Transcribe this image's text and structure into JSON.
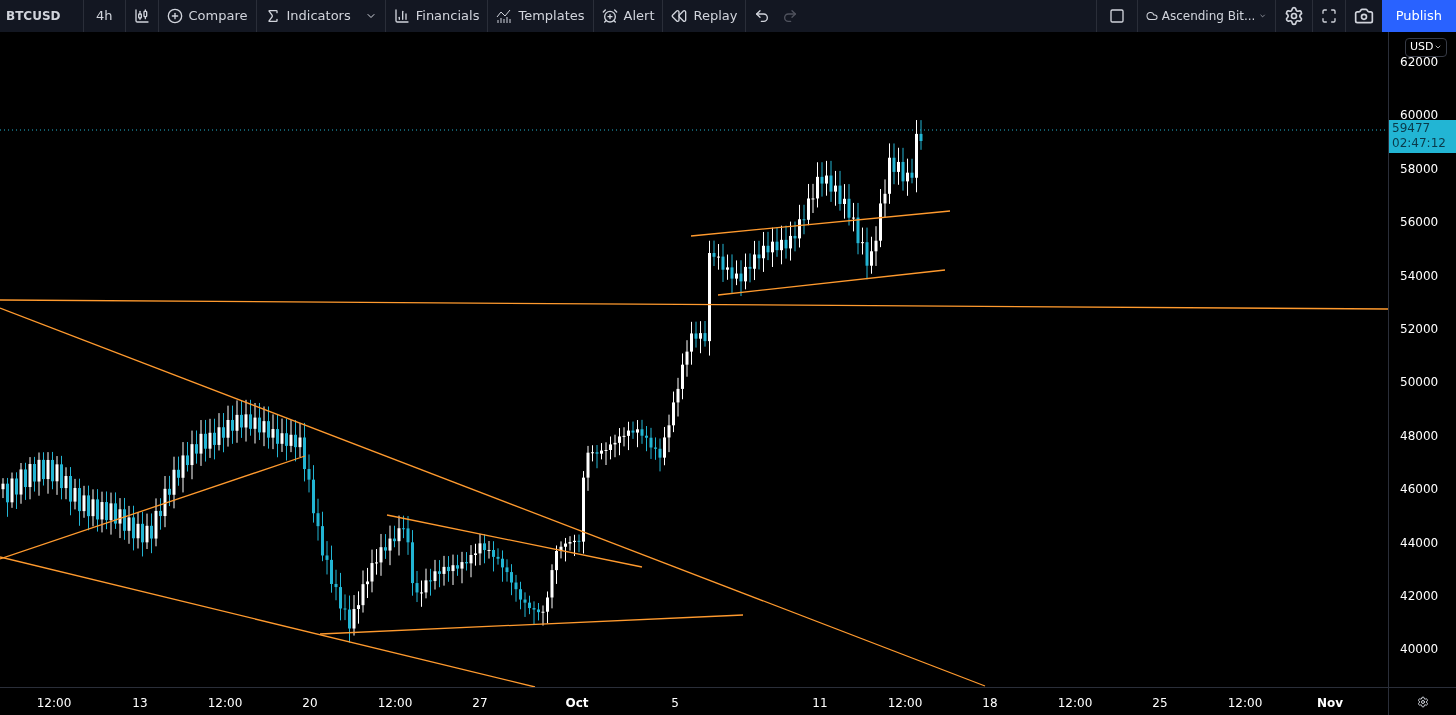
{
  "toolbar": {
    "symbol": "BTCUSD",
    "interval": "4h",
    "items": [
      {
        "kind": "compare",
        "label": "Compare"
      },
      {
        "kind": "indicators",
        "label": "Indicators"
      },
      {
        "kind": "financials",
        "label": "Financials"
      },
      {
        "kind": "templates",
        "label": "Templates"
      },
      {
        "kind": "alert",
        "label": "Alert"
      },
      {
        "kind": "replay",
        "label": "Replay"
      }
    ],
    "layout_name": "Ascending Bit...",
    "publish_label": "Publish"
  },
  "price_axis": {
    "currency": "USD",
    "ticks": [
      "62000",
      "60000",
      "58000",
      "56000",
      "54000",
      "52000",
      "50000",
      "48000",
      "46000",
      "44000",
      "42000",
      "40000"
    ],
    "last_price": "59477",
    "countdown": "02:47:12"
  },
  "time_axis": [
    {
      "label": "12:00",
      "bold": false
    },
    {
      "label": "13",
      "bold": false
    },
    {
      "label": "12:00",
      "bold": false
    },
    {
      "label": "20",
      "bold": false
    },
    {
      "label": "12:00",
      "bold": false
    },
    {
      "label": "27",
      "bold": false
    },
    {
      "label": "Oct",
      "bold": true
    },
    {
      "label": "5",
      "bold": false
    },
    {
      "label": "11",
      "bold": false
    },
    {
      "label": "12:00",
      "bold": false
    },
    {
      "label": "18",
      "bold": false
    },
    {
      "label": "12:00",
      "bold": false
    },
    {
      "label": "25",
      "bold": false
    },
    {
      "label": "12:00",
      "bold": false
    },
    {
      "label": "Nov",
      "bold": true
    }
  ]
}
